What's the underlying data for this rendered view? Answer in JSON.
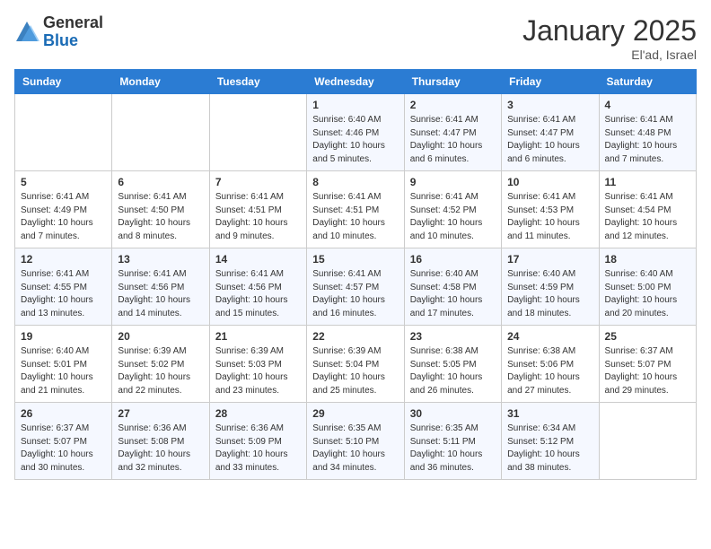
{
  "header": {
    "logo_general": "General",
    "logo_blue": "Blue",
    "title": "January 2025",
    "subtitle": "El'ad, Israel"
  },
  "weekdays": [
    "Sunday",
    "Monday",
    "Tuesday",
    "Wednesday",
    "Thursday",
    "Friday",
    "Saturday"
  ],
  "weeks": [
    [
      {
        "day": "",
        "info": ""
      },
      {
        "day": "",
        "info": ""
      },
      {
        "day": "",
        "info": ""
      },
      {
        "day": "1",
        "info": "Sunrise: 6:40 AM\nSunset: 4:46 PM\nDaylight: 10 hours\nand 5 minutes."
      },
      {
        "day": "2",
        "info": "Sunrise: 6:41 AM\nSunset: 4:47 PM\nDaylight: 10 hours\nand 6 minutes."
      },
      {
        "day": "3",
        "info": "Sunrise: 6:41 AM\nSunset: 4:47 PM\nDaylight: 10 hours\nand 6 minutes."
      },
      {
        "day": "4",
        "info": "Sunrise: 6:41 AM\nSunset: 4:48 PM\nDaylight: 10 hours\nand 7 minutes."
      }
    ],
    [
      {
        "day": "5",
        "info": "Sunrise: 6:41 AM\nSunset: 4:49 PM\nDaylight: 10 hours\nand 7 minutes."
      },
      {
        "day": "6",
        "info": "Sunrise: 6:41 AM\nSunset: 4:50 PM\nDaylight: 10 hours\nand 8 minutes."
      },
      {
        "day": "7",
        "info": "Sunrise: 6:41 AM\nSunset: 4:51 PM\nDaylight: 10 hours\nand 9 minutes."
      },
      {
        "day": "8",
        "info": "Sunrise: 6:41 AM\nSunset: 4:51 PM\nDaylight: 10 hours\nand 10 minutes."
      },
      {
        "day": "9",
        "info": "Sunrise: 6:41 AM\nSunset: 4:52 PM\nDaylight: 10 hours\nand 10 minutes."
      },
      {
        "day": "10",
        "info": "Sunrise: 6:41 AM\nSunset: 4:53 PM\nDaylight: 10 hours\nand 11 minutes."
      },
      {
        "day": "11",
        "info": "Sunrise: 6:41 AM\nSunset: 4:54 PM\nDaylight: 10 hours\nand 12 minutes."
      }
    ],
    [
      {
        "day": "12",
        "info": "Sunrise: 6:41 AM\nSunset: 4:55 PM\nDaylight: 10 hours\nand 13 minutes."
      },
      {
        "day": "13",
        "info": "Sunrise: 6:41 AM\nSunset: 4:56 PM\nDaylight: 10 hours\nand 14 minutes."
      },
      {
        "day": "14",
        "info": "Sunrise: 6:41 AM\nSunset: 4:56 PM\nDaylight: 10 hours\nand 15 minutes."
      },
      {
        "day": "15",
        "info": "Sunrise: 6:41 AM\nSunset: 4:57 PM\nDaylight: 10 hours\nand 16 minutes."
      },
      {
        "day": "16",
        "info": "Sunrise: 6:40 AM\nSunset: 4:58 PM\nDaylight: 10 hours\nand 17 minutes."
      },
      {
        "day": "17",
        "info": "Sunrise: 6:40 AM\nSunset: 4:59 PM\nDaylight: 10 hours\nand 18 minutes."
      },
      {
        "day": "18",
        "info": "Sunrise: 6:40 AM\nSunset: 5:00 PM\nDaylight: 10 hours\nand 20 minutes."
      }
    ],
    [
      {
        "day": "19",
        "info": "Sunrise: 6:40 AM\nSunset: 5:01 PM\nDaylight: 10 hours\nand 21 minutes."
      },
      {
        "day": "20",
        "info": "Sunrise: 6:39 AM\nSunset: 5:02 PM\nDaylight: 10 hours\nand 22 minutes."
      },
      {
        "day": "21",
        "info": "Sunrise: 6:39 AM\nSunset: 5:03 PM\nDaylight: 10 hours\nand 23 minutes."
      },
      {
        "day": "22",
        "info": "Sunrise: 6:39 AM\nSunset: 5:04 PM\nDaylight: 10 hours\nand 25 minutes."
      },
      {
        "day": "23",
        "info": "Sunrise: 6:38 AM\nSunset: 5:05 PM\nDaylight: 10 hours\nand 26 minutes."
      },
      {
        "day": "24",
        "info": "Sunrise: 6:38 AM\nSunset: 5:06 PM\nDaylight: 10 hours\nand 27 minutes."
      },
      {
        "day": "25",
        "info": "Sunrise: 6:37 AM\nSunset: 5:07 PM\nDaylight: 10 hours\nand 29 minutes."
      }
    ],
    [
      {
        "day": "26",
        "info": "Sunrise: 6:37 AM\nSunset: 5:07 PM\nDaylight: 10 hours\nand 30 minutes."
      },
      {
        "day": "27",
        "info": "Sunrise: 6:36 AM\nSunset: 5:08 PM\nDaylight: 10 hours\nand 32 minutes."
      },
      {
        "day": "28",
        "info": "Sunrise: 6:36 AM\nSunset: 5:09 PM\nDaylight: 10 hours\nand 33 minutes."
      },
      {
        "day": "29",
        "info": "Sunrise: 6:35 AM\nSunset: 5:10 PM\nDaylight: 10 hours\nand 34 minutes."
      },
      {
        "day": "30",
        "info": "Sunrise: 6:35 AM\nSunset: 5:11 PM\nDaylight: 10 hours\nand 36 minutes."
      },
      {
        "day": "31",
        "info": "Sunrise: 6:34 AM\nSunset: 5:12 PM\nDaylight: 10 hours\nand 38 minutes."
      },
      {
        "day": "",
        "info": ""
      }
    ]
  ]
}
